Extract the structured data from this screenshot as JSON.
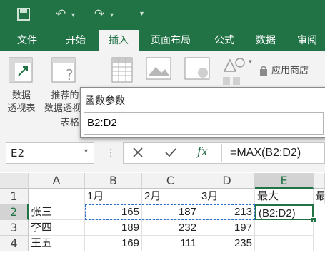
{
  "colors": {
    "brand": "#217346",
    "ribbon_bg": "#f3f3f3",
    "selection": "#217346"
  },
  "quick_access": {
    "icons": [
      "save-icon",
      "undo-icon",
      "redo-icon",
      "customize-icon"
    ]
  },
  "tabs": [
    {
      "label": "文件",
      "active": false
    },
    {
      "label": "开始",
      "active": false
    },
    {
      "label": "插入",
      "active": true
    },
    {
      "label": "页面布局",
      "active": false
    },
    {
      "label": "公式",
      "active": false
    },
    {
      "label": "数据",
      "active": false
    },
    {
      "label": "审阅",
      "active": false
    }
  ],
  "ribbon": {
    "pivot_line1": "数据",
    "pivot_line2": "透视表",
    "recommended_line1": "推荐的",
    "recommended_line2": "数据透视",
    "group_label": "表格",
    "store_label": "应用商店"
  },
  "dialog": {
    "title": "函数参数",
    "value": "B2:D2"
  },
  "formula_bar": {
    "name_box": "E2",
    "formula": "=MAX(B2:D2)"
  },
  "sheet": {
    "columns": [
      "A",
      "B",
      "C",
      "D",
      "E"
    ],
    "rows": [
      {
        "num": "1",
        "A": "",
        "B": "1月",
        "C": "2月",
        "D": "3月",
        "E": "最大",
        "F": "最"
      },
      {
        "num": "2",
        "A": "张三",
        "B": "165",
        "C": "187",
        "D": "213",
        "E": "(B2:D2)"
      },
      {
        "num": "3",
        "A": "李四",
        "B": "189",
        "C": "232",
        "D": "197",
        "E": ""
      },
      {
        "num": "4",
        "A": "王五",
        "B": "169",
        "C": "111",
        "D": "235",
        "E": ""
      }
    ]
  }
}
